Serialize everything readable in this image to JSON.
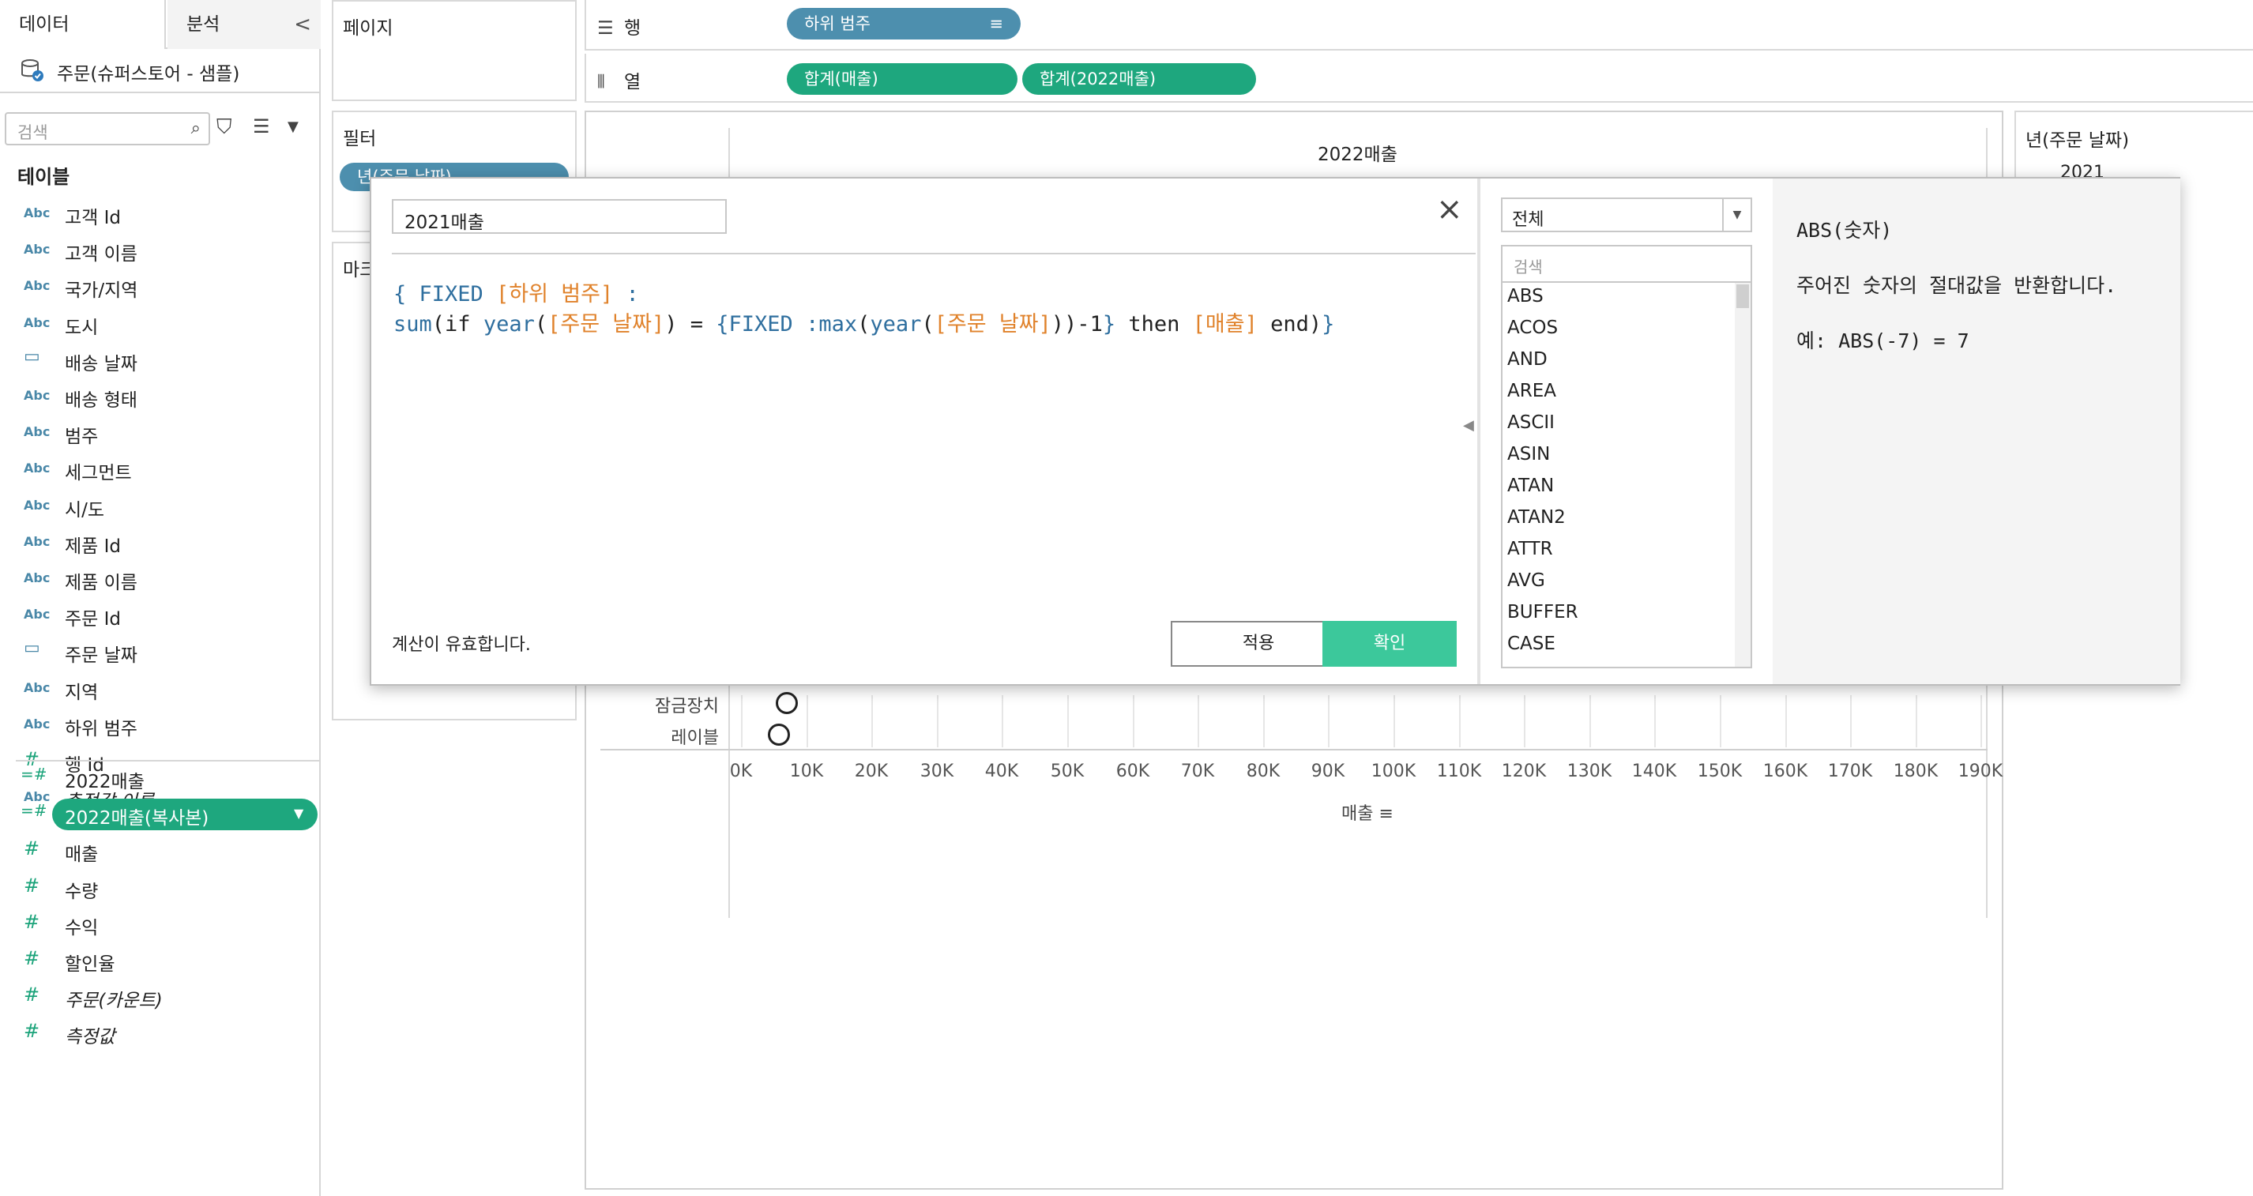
{
  "tabs": {
    "data": "데이터",
    "analysis": "분석",
    "collapse": "<"
  },
  "datasource": {
    "name": "주문(슈퍼스토어 - 샘플)"
  },
  "search": {
    "placeholder": "검색"
  },
  "tables_title": "테이블",
  "fields": [
    {
      "type": "Abc",
      "name": "고객 Id"
    },
    {
      "type": "Abc",
      "name": "고객 이름"
    },
    {
      "type": "Abc",
      "name": "국가/지역"
    },
    {
      "type": "Abc",
      "name": "도시"
    },
    {
      "type": "date",
      "name": "배송 날짜"
    },
    {
      "type": "Abc",
      "name": "배송 형태"
    },
    {
      "type": "Abc",
      "name": "범주"
    },
    {
      "type": "Abc",
      "name": "세그먼트"
    },
    {
      "type": "Abc",
      "name": "시/도"
    },
    {
      "type": "Abc",
      "name": "제품 Id"
    },
    {
      "type": "Abc",
      "name": "제품 이름"
    },
    {
      "type": "Abc",
      "name": "주문 Id"
    },
    {
      "type": "date",
      "name": "주문 날짜"
    },
    {
      "type": "Abc",
      "name": "지역"
    },
    {
      "type": "Abc",
      "name": "하위 범주"
    },
    {
      "type": "#",
      "name": "행 Id"
    },
    {
      "type": "Abc",
      "name": "측정값 이름"
    }
  ],
  "measures": [
    {
      "type": "=#",
      "name": "2022매출"
    },
    {
      "type": "=#",
      "name": "2022매출(복사본)"
    },
    {
      "type": "#",
      "name": "매출"
    },
    {
      "type": "#",
      "name": "수량"
    },
    {
      "type": "#",
      "name": "수익"
    },
    {
      "type": "#",
      "name": "할인율"
    },
    {
      "type": "#",
      "name": "주문(카운트)"
    },
    {
      "type": "#",
      "name": "측정값"
    }
  ],
  "cards": {
    "pages": "페이지",
    "filters": "필터",
    "filter_pill": "년(주문 날짜)",
    "marks": "마크"
  },
  "shelves": {
    "rows_label": "행",
    "rows_pill": "하위 범주",
    "cols_label": "열",
    "cols_pills": [
      "합계(매출)",
      "합계(2022매출)"
    ]
  },
  "view": {
    "header": "2022매출",
    "row_labels": [
      "잠금장치",
      "레이블"
    ],
    "axis_title": "매출",
    "ticks": [
      "0K",
      "10K",
      "20K",
      "30K",
      "40K",
      "50K",
      "60K",
      "70K",
      "80K",
      "90K",
      "100K",
      "110K",
      "120K",
      "130K",
      "140K",
      "150K",
      "160K",
      "170K",
      "180K",
      "190K"
    ]
  },
  "legend": {
    "title": "년(주문 날짜)",
    "item": "2021"
  },
  "dialog": {
    "calc_name": "2021매출",
    "status": "계산이 유효합니다.",
    "apply": "적용",
    "ok": "확인",
    "code_line1": [
      {
        "c": "kw",
        "t": "{ FIXED "
      },
      {
        "c": "fld",
        "t": "[하위 범주]"
      },
      {
        "c": "kw",
        "t": " :"
      }
    ],
    "code_line2": [
      {
        "c": "kw",
        "t": "sum"
      },
      {
        "c": "txt",
        "t": "(if "
      },
      {
        "c": "kw",
        "t": "year"
      },
      {
        "c": "txt",
        "t": "("
      },
      {
        "c": "fld",
        "t": "[주문 날짜]"
      },
      {
        "c": "txt",
        "t": ") = "
      },
      {
        "c": "kw",
        "t": "{FIXED :max"
      },
      {
        "c": "txt",
        "t": "("
      },
      {
        "c": "kw",
        "t": "year"
      },
      {
        "c": "txt",
        "t": "("
      },
      {
        "c": "fld",
        "t": "[주문 날짜]"
      },
      {
        "c": "txt",
        "t": "))-1"
      },
      {
        "c": "kw",
        "t": "}"
      },
      {
        "c": "txt",
        "t": " then "
      },
      {
        "c": "fld",
        "t": "[매출]"
      },
      {
        "c": "txt",
        "t": " end)"
      },
      {
        "c": "kw",
        "t": "}"
      }
    ],
    "category": "전체",
    "fn_search_placeholder": "검색",
    "functions": [
      "ABS",
      "ACOS",
      "AND",
      "AREA",
      "ASCII",
      "ASIN",
      "ATAN",
      "ATAN2",
      "ATTR",
      "AVG",
      "BUFFER",
      "CASE"
    ],
    "help_title": "ABS(숫자)",
    "help_desc": "주어진 숫자의 절대값을 반환합니다.",
    "help_example": "예: ABS(-7) = 7"
  },
  "colors": {
    "green_pill": "#1ea77e",
    "blue_pill": "#4d8fae",
    "ok_button": "#3cc89b",
    "keyword": "#2f6f9f",
    "field_ref": "#e0822b"
  }
}
